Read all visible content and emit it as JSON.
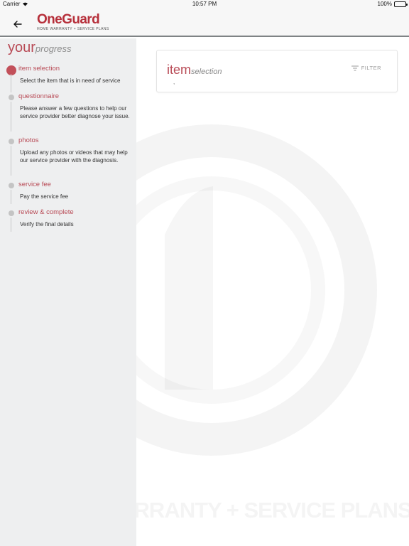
{
  "status_bar": {
    "carrier": "Carrier",
    "time": "10:57 PM",
    "battery": "100%"
  },
  "header": {
    "logo": {
      "brand": "OneGuard",
      "tagline": "HOME WARRANTY + SERVICE PLANS"
    }
  },
  "sidebar": {
    "title_big": "your",
    "title_small": "progress",
    "steps": [
      {
        "label": "item selection",
        "description": "Select the item that is in need of service",
        "active": true
      },
      {
        "label": "questionnaire",
        "description": "Please answer a few questions to help our service provider better diagnose your issue.",
        "active": false
      },
      {
        "label": "photos",
        "description": "Upload any photos or videos that may help our service provider with the diagnosis.",
        "active": false
      },
      {
        "label": "service fee",
        "description": "Pay the service fee",
        "active": false
      },
      {
        "label": "review & complete",
        "description": "Verify the final details",
        "active": false
      }
    ]
  },
  "main": {
    "card_title_big": "item",
    "card_title_small": "selection",
    "card_subtext": ",",
    "filter_label": "FILTER"
  },
  "watermark": {
    "text": "HOME WARRANTY + SERVICE PLANS"
  },
  "colors": {
    "brand": "#b62f3a",
    "accent": "#c2505a",
    "sidebar_bg": "#eeeff0"
  },
  "icons": [
    "back-arrow-icon",
    "wifi-icon",
    "battery-icon",
    "filter-icon",
    "logo-o-icon",
    "watermark-logo-icon"
  ]
}
